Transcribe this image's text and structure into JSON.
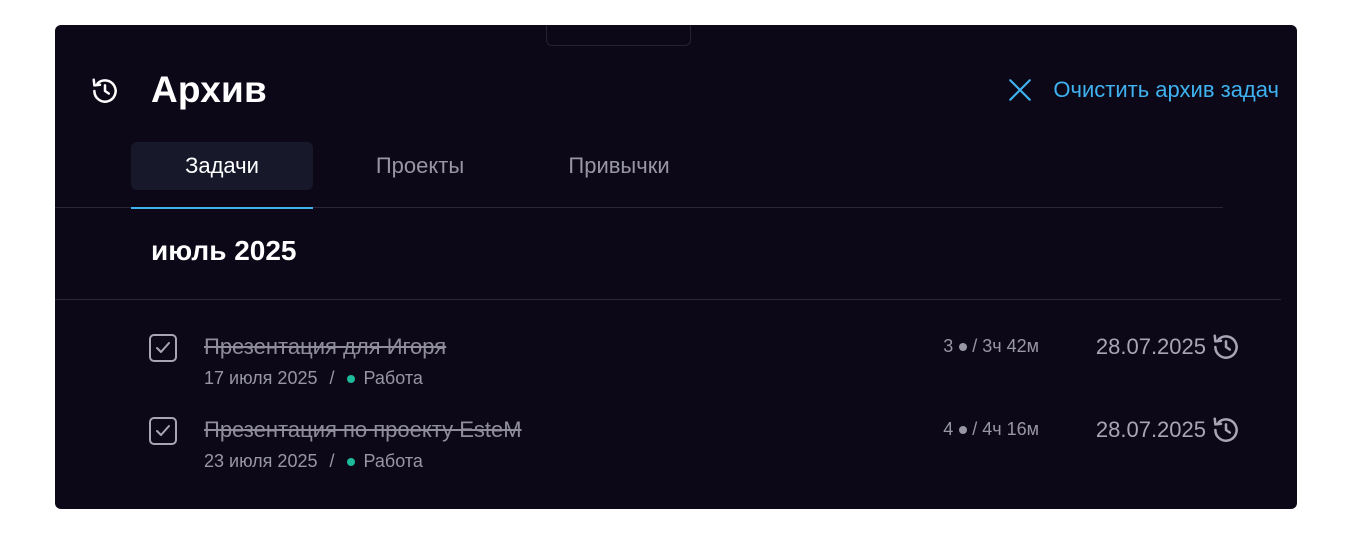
{
  "header": {
    "icon": "history-icon",
    "title": "Архив",
    "clear_button": {
      "icon": "close-icon",
      "label": "Очистить архив задач"
    }
  },
  "tabs": [
    {
      "label": "Задачи",
      "active": true
    },
    {
      "label": "Проекты",
      "active": false
    },
    {
      "label": "Привычки",
      "active": false
    }
  ],
  "groups": [
    {
      "month": "июль 2025",
      "tasks": [
        {
          "title": "Презентация для Игоря",
          "created": "17 июля 2025",
          "separator": "/",
          "list": "Работа",
          "sessions": "3",
          "duration": "/ 3ч 42м",
          "archived_date": "28.07.2025",
          "done": true
        },
        {
          "title": "Презентация по проекту EsteM",
          "created": "23 июля 2025",
          "separator": "/",
          "list": "Работа",
          "sessions": "4",
          "duration": "/ 4ч 16м",
          "archived_date": "28.07.2025",
          "done": true
        }
      ]
    }
  ],
  "colors": {
    "background": "#0c0818",
    "accent": "#3fb2f0",
    "list_dot": "#1dbb9c",
    "active_tab_bg": "#17192b"
  }
}
